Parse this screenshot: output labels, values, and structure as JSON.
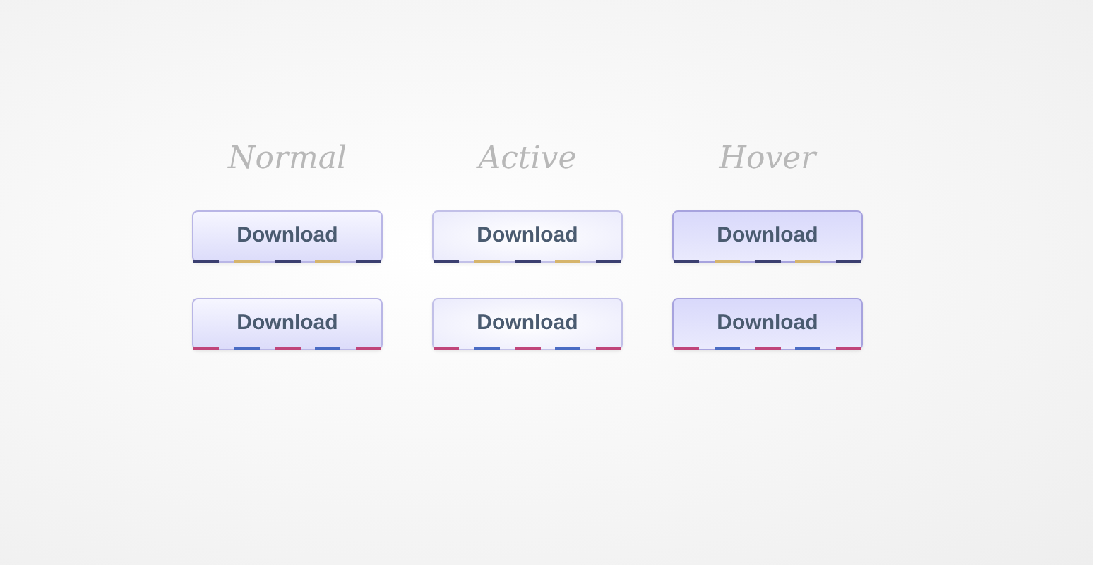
{
  "states": [
    {
      "label": "Normal",
      "kind": "normal"
    },
    {
      "label": "Active",
      "kind": "active"
    },
    {
      "label": "Hover",
      "kind": "hover"
    }
  ],
  "rows": [
    {
      "buttons": [
        {
          "label": "Download"
        },
        {
          "label": "Download"
        },
        {
          "label": "Download"
        }
      ],
      "stripes": [
        {
          "color": "#3b3f70"
        },
        {
          "color": "#d6b56c"
        },
        {
          "color": "#3b3f70"
        },
        {
          "color": "#d6b56c"
        },
        {
          "color": "#3b3f70"
        }
      ]
    },
    {
      "buttons": [
        {
          "label": "Download"
        },
        {
          "label": "Download"
        },
        {
          "label": "Download"
        }
      ],
      "stripes": [
        {
          "color": "#c0457a"
        },
        {
          "color": "#4a6cc4"
        },
        {
          "color": "#c0457a"
        },
        {
          "color": "#4a6cc4"
        },
        {
          "color": "#c0457a"
        }
      ]
    }
  ]
}
